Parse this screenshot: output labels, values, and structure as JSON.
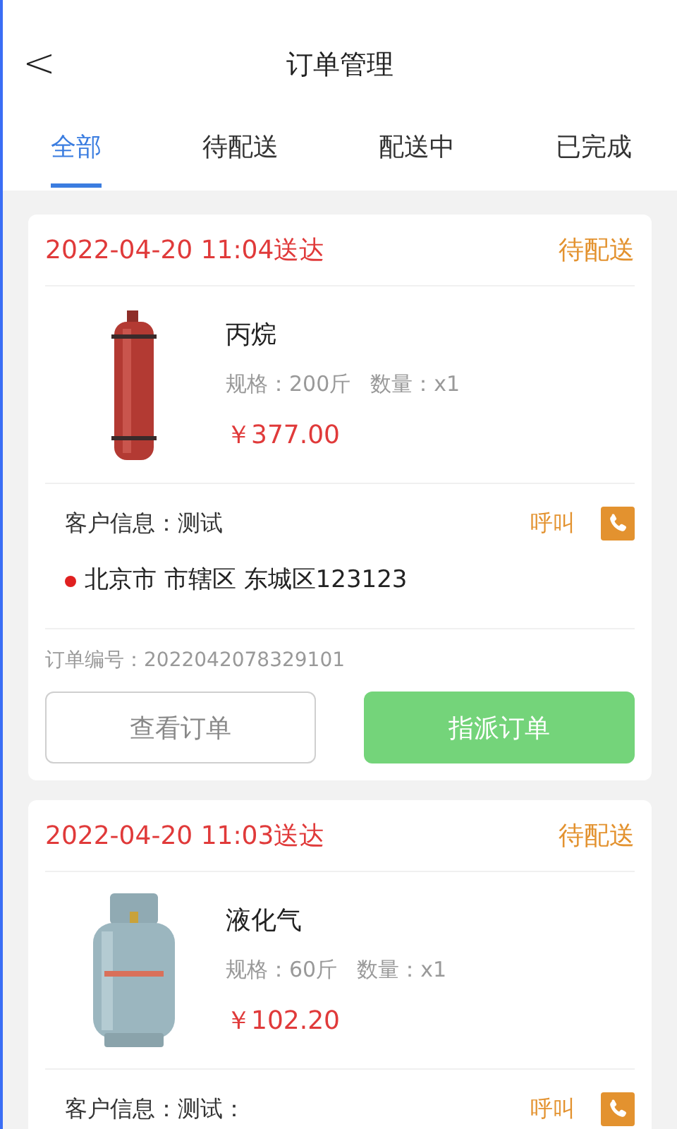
{
  "header": {
    "back": "<",
    "title": "订单管理"
  },
  "tabs": [
    {
      "label": "全部",
      "selected": true
    },
    {
      "label": "待配送",
      "selected": false
    },
    {
      "label": "配送中",
      "selected": false
    },
    {
      "label": "已完成",
      "selected": false
    }
  ],
  "orders": [
    {
      "time": "2022-04-20 11:04送达",
      "status": "待配送",
      "product": {
        "kind": "picture",
        "name": "丙烷",
        "spec": "规格：200斤",
        "qty": "数量：x1",
        "price": "￥377.00"
      },
      "customer": "客户信息：测试",
      "call": "呼叫",
      "address": "北京市 市辖区 东城区123123",
      "order_no": "订单编号：2022042078329101",
      "buttons": [
        {
          "label": "查看订单",
          "kind": "outline"
        },
        {
          "label": "指派订单",
          "kind": "primary"
        }
      ]
    },
    {
      "time": "2022-04-20 11:03送达",
      "status": "待配送",
      "product": {
        "kind": "picture",
        "name": "液化气",
        "spec": "规格：60斤",
        "qty": "数量：x1",
        "price": "￥102.20"
      },
      "customer": "客户信息：测试：",
      "call": "呼叫"
    }
  ]
}
